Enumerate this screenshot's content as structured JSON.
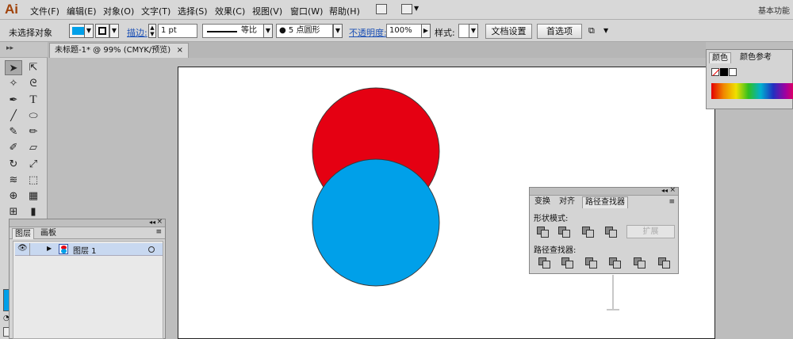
{
  "app": {
    "logo": "Ai",
    "workspace": "基本功能"
  },
  "menu": [
    "文件(F)",
    "编辑(E)",
    "对象(O)",
    "文字(T)",
    "选择(S)",
    "效果(C)",
    "视图(V)",
    "窗口(W)",
    "帮助(H)"
  ],
  "control": {
    "selection_label": "未选择对象",
    "stroke_label": "描边:",
    "stroke_weight": "1 pt",
    "profile_label": "等比",
    "brush_label": "5 点圆形",
    "opacity_label": "不透明度:",
    "opacity_value": "100%",
    "style_label": "样式:",
    "doc_setup": "文档设置",
    "preferences": "首选项"
  },
  "document": {
    "tab_title": "未标题-1* @ 99% (CMYK/预览)",
    "close": "×"
  },
  "layers_panel": {
    "tabs": [
      "图层",
      "画板"
    ],
    "layer_name": "图层 1"
  },
  "color_panel": {
    "tabs": [
      "颜色",
      "颜色参考"
    ]
  },
  "pathfinder_panel": {
    "tabs": [
      "变换",
      "对齐",
      "路径查找器"
    ],
    "shape_modes": "形状模式:",
    "pathfinders": "路径查找器:",
    "expand": "扩展"
  },
  "colors": {
    "red_circle": "#e50012",
    "blue_circle": "#00a0e9",
    "fill_swatch": "#00a0e9"
  }
}
